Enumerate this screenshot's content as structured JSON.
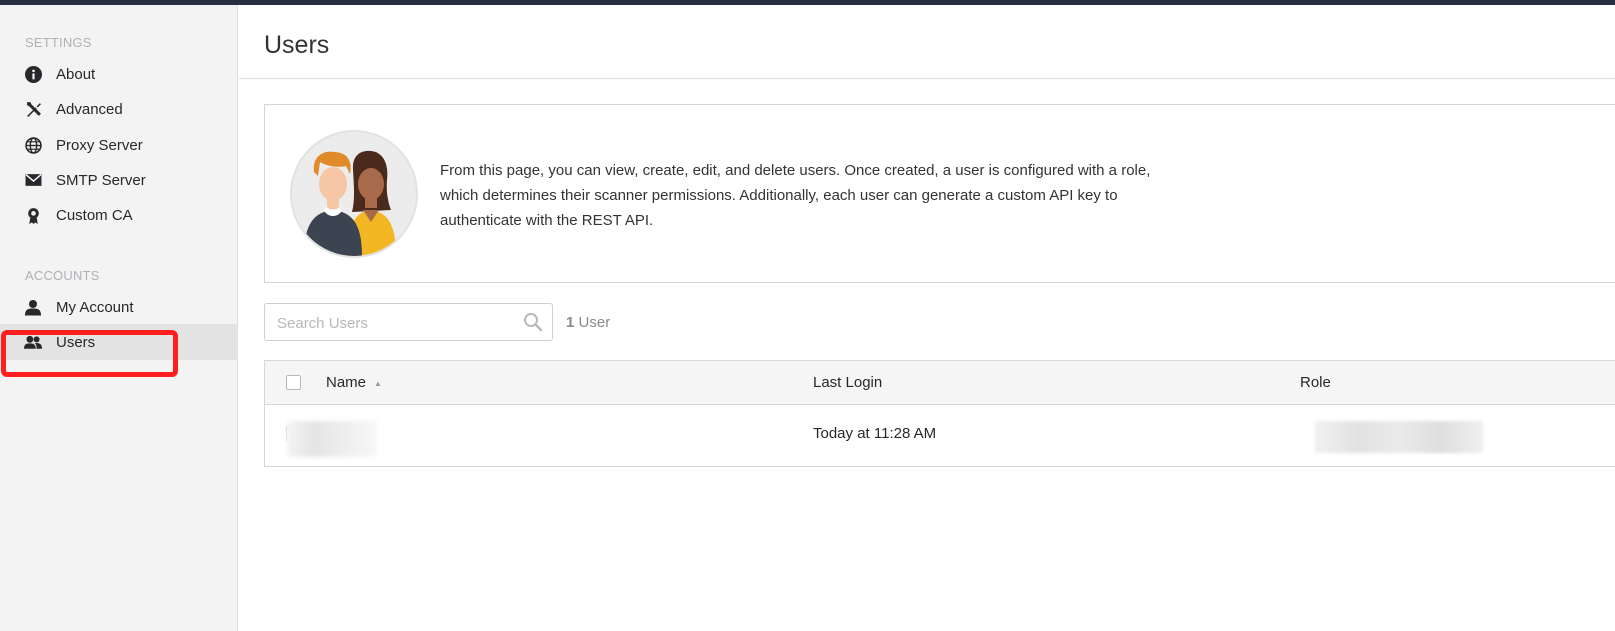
{
  "sidebar": {
    "settings_label": "SETTINGS",
    "accounts_label": "ACCOUNTS",
    "items": [
      {
        "label": "About",
        "icon": "info-icon"
      },
      {
        "label": "Advanced",
        "icon": "tools-icon"
      },
      {
        "label": "Proxy Server",
        "icon": "globe-icon"
      },
      {
        "label": "SMTP Server",
        "icon": "envelope-icon"
      },
      {
        "label": "Custom CA",
        "icon": "certificate-icon"
      },
      {
        "label": "My Account",
        "icon": "user-icon"
      },
      {
        "label": "Users",
        "icon": "users-icon",
        "active": true
      }
    ]
  },
  "page": {
    "title": "Users"
  },
  "info": {
    "text": "From this page, you can view, create, edit, and delete users. Once created, a user is configured with a role, which determines their scanner permissions. Additionally, each user can generate a custom API key to authenticate with the REST API."
  },
  "search": {
    "placeholder": "Search Users",
    "value": ""
  },
  "user_count": {
    "number": "1",
    "label": "User"
  },
  "table": {
    "columns": [
      "Name",
      "Last Login",
      "Role"
    ],
    "rows": [
      {
        "name": "",
        "last_login": "Today at 11:28 AM",
        "role": ""
      }
    ]
  },
  "colors": {
    "topbar": "#263040",
    "sidebar_bg": "#f3f3f3",
    "active_item_bg": "#e3e3e3",
    "highlight": "#ff1f1f"
  }
}
